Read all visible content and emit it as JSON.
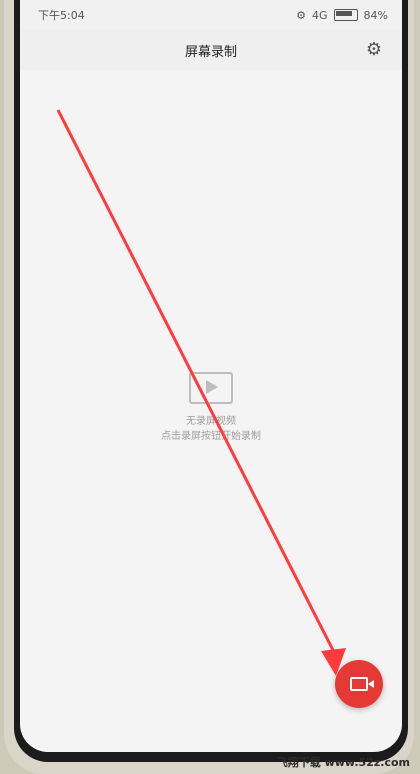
{
  "status": {
    "time": "下午5:04",
    "network": "4G",
    "battery": "84%"
  },
  "title": "屏幕录制",
  "empty_state": {
    "line1": "无录屏视频",
    "line2": "点击录屏按钮开始录制"
  },
  "watermark": "飞翔下载 www.52z.com"
}
